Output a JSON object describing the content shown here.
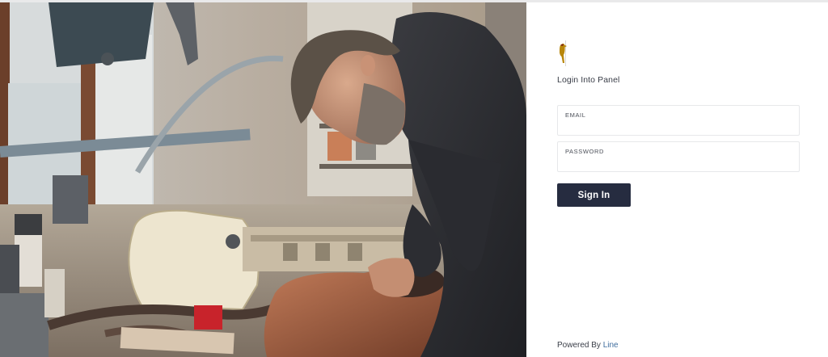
{
  "login": {
    "title": "Login Into Panel",
    "email": {
      "label": "EMAIL",
      "value": ""
    },
    "password": {
      "label": "PASSWORD",
      "value": ""
    },
    "submit_label": "Sign In"
  },
  "footer": {
    "powered_by": "Powered By",
    "brand": "Line"
  },
  "colors": {
    "button": "#262c40",
    "brand_link": "#3f6d9e",
    "logo": "#b8860b"
  },
  "icons": {
    "logo": "woodpecker-logo-icon"
  }
}
